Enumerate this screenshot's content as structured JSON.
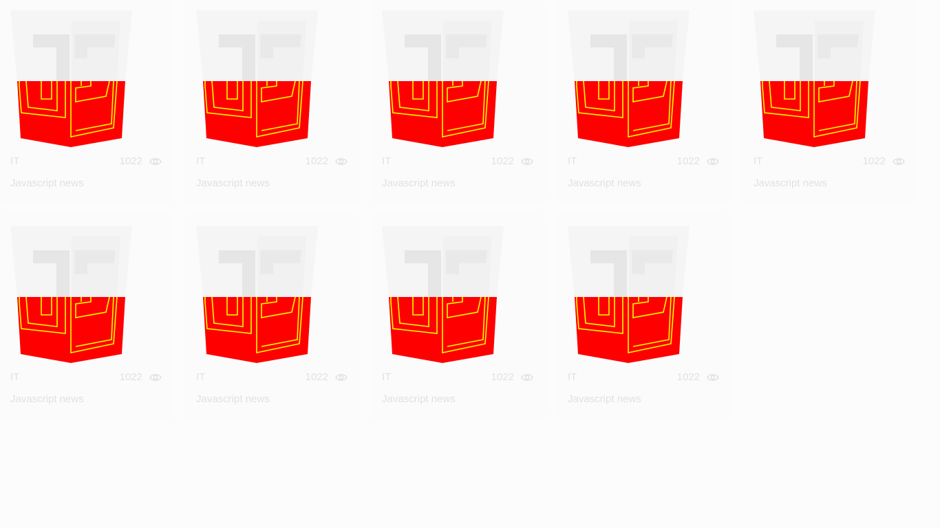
{
  "colors": {
    "background": "#fcfcfc",
    "card": "#fbfbfb",
    "text": "#e1e1e1",
    "shield_red": "#ff0000",
    "shield_lines": "#ffff00"
  },
  "cards": [
    {
      "category": "IT",
      "views": "1022",
      "title": "Javascript news",
      "icon": "js-shield-logo"
    },
    {
      "category": "IT",
      "views": "1022",
      "title": "Javascript news",
      "icon": "js-shield-logo"
    },
    {
      "category": "IT",
      "views": "1022",
      "title": "Javascript news",
      "icon": "js-shield-logo"
    },
    {
      "category": "IT",
      "views": "1022",
      "title": "Javascript news",
      "icon": "js-shield-logo"
    },
    {
      "category": "IT",
      "views": "1022",
      "title": "Javascript news",
      "icon": "js-shield-logo"
    },
    {
      "category": "IT",
      "views": "1022",
      "title": "Javascript news",
      "icon": "js-shield-logo"
    },
    {
      "category": "IT",
      "views": "1022",
      "title": "Javascript news",
      "icon": "js-shield-logo"
    },
    {
      "category": "IT",
      "views": "1022",
      "title": "Javascript news",
      "icon": "js-shield-logo"
    },
    {
      "category": "IT",
      "views": "1022",
      "title": "Javascript news",
      "icon": "js-shield-logo"
    }
  ]
}
